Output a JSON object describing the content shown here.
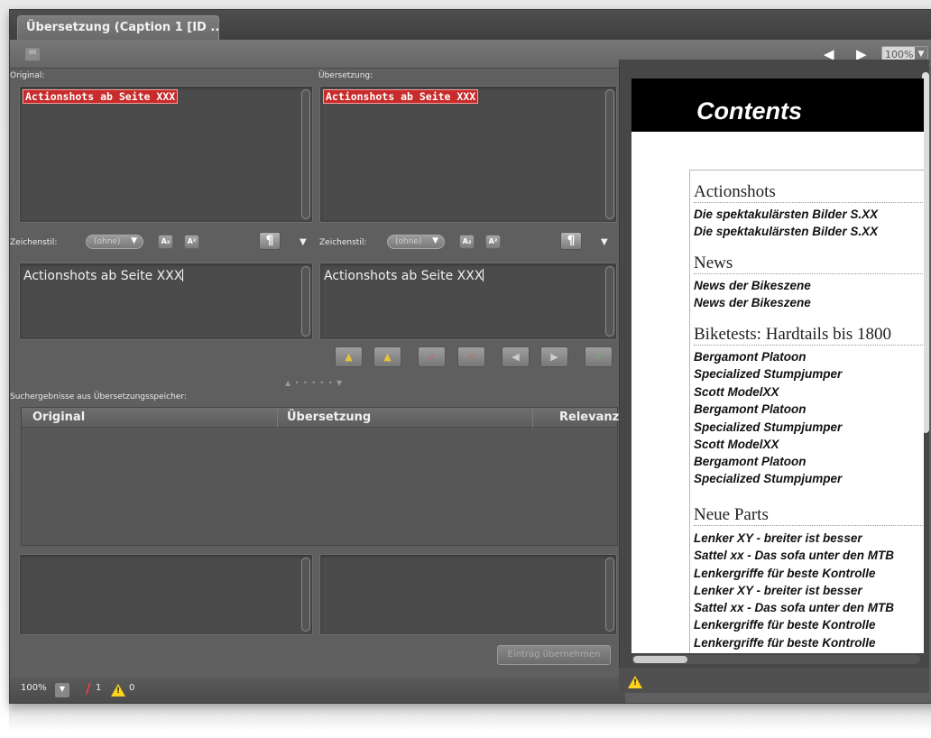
{
  "tab": {
    "title": "Übersetzung (Caption 1 [ID ..."
  },
  "toolbar": {
    "zoom": "100%"
  },
  "editor": {
    "original_label": "Original:",
    "translation_label": "Übersetzung:",
    "original_tagged": "Actionshots ab Seite XXX",
    "translation_tagged": "Actionshots ab Seite XXX",
    "charstyle_label": "Zeichenstil:",
    "charstyle_value": "(ohne)",
    "original_plain": "Actionshots ab Seite XXX",
    "translation_plain": "Actionshots ab Seite XXX"
  },
  "search": {
    "label": "Suchergebnisse aus Übersetzungsspeicher:",
    "columns": [
      "Original",
      "Übersetzung",
      "Relevanz"
    ],
    "apply_button": "Eintrag übernehmen"
  },
  "status": {
    "zoom": "100%",
    "errors": "1",
    "warnings": "0"
  },
  "preview": {
    "title": "Contents",
    "sections": [
      {
        "heading": "Actionshots",
        "entries": [
          "Die spektakulärsten Bilder S.XX",
          "Die spektakulärsten Bilder S.XX"
        ]
      },
      {
        "heading": "News",
        "entries": [
          "News der Bikeszene",
          "News der Bikeszene"
        ]
      },
      {
        "heading": "Biketests: Hardtails bis 1800",
        "entries": [
          "Bergamont Platoon",
          "Specialized Stumpjumper",
          "Scott ModelXX",
          "Bergamont Platoon",
          "Specialized Stumpjumper",
          "Scott ModelXX",
          "Bergamont Platoon",
          "Specialized Stumpjumper"
        ]
      },
      {
        "heading": "Neue Parts",
        "entries": [
          "Lenker XY - breiter ist besser",
          "Sattel xx - Das sofa unter den MTB",
          "Lenkergriffe für beste Kontrolle",
          "Lenker XY - breiter ist besser",
          "Sattel xx - Das sofa unter den MTB",
          "Lenkergriffe für beste Kontrolle",
          "Lenkergriffe für beste Kontrolle"
        ]
      }
    ]
  },
  "colors": {
    "highlight": "#c72b2b",
    "warning": "#ffd21e",
    "error": "#ff3b3b"
  },
  "icons": [
    "save-icon",
    "arrow-left-icon",
    "arrow-right-icon",
    "pilcrow-icon",
    "warning-icon",
    "error-icon"
  ]
}
